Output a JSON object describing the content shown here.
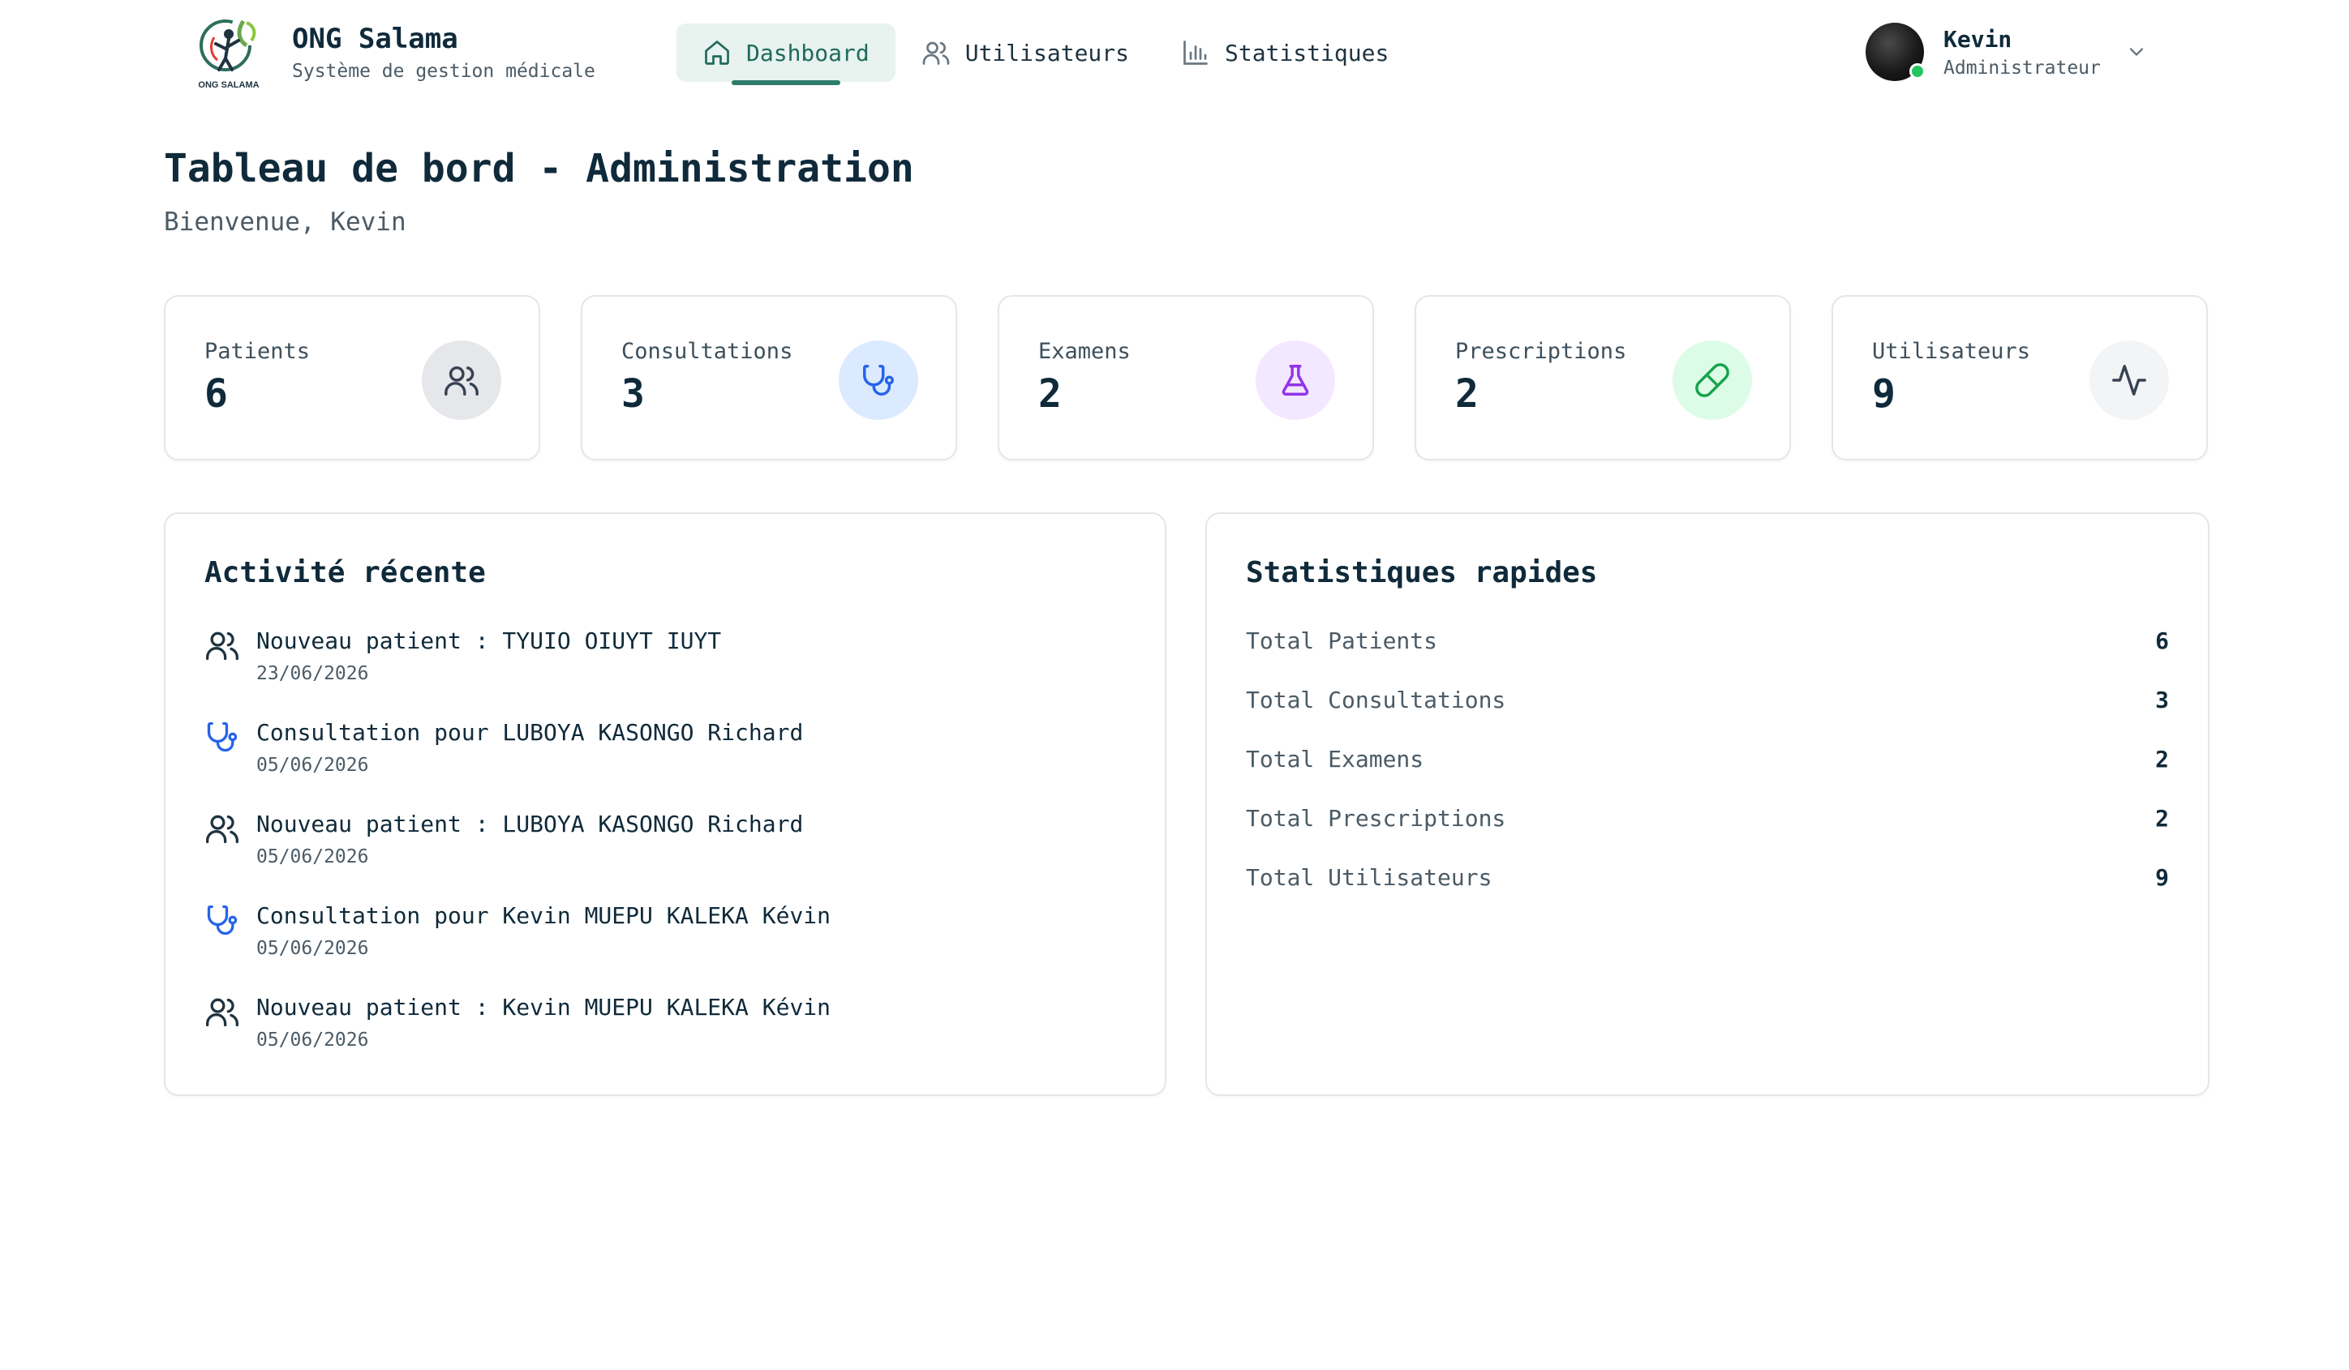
{
  "brand": {
    "title": "ONG Salama",
    "subtitle": "Système de gestion médicale",
    "logo_text": "ONG SALAMA"
  },
  "nav": {
    "items": [
      {
        "label": "Dashboard",
        "icon": "home-icon",
        "active": true
      },
      {
        "label": "Utilisateurs",
        "icon": "users-icon",
        "active": false
      },
      {
        "label": "Statistiques",
        "icon": "bar-chart-icon",
        "active": false
      }
    ]
  },
  "user": {
    "name": "Kevin",
    "role": "Administrateur",
    "status_color": "#22c55e"
  },
  "page": {
    "title": "Tableau de bord - Administration",
    "welcome": "Bienvenue, Kevin"
  },
  "cards": [
    {
      "label": "Patients",
      "value": "6",
      "icon": "users-icon",
      "icon_bg": "#e5e7eb",
      "icon_color": "#374151"
    },
    {
      "label": "Consultations",
      "value": "3",
      "icon": "stethoscope-icon",
      "icon_bg": "#dbeafe",
      "icon_color": "#2563eb"
    },
    {
      "label": "Examens",
      "value": "2",
      "icon": "flask-icon",
      "icon_bg": "#f3e8ff",
      "icon_color": "#9333ea"
    },
    {
      "label": "Prescriptions",
      "value": "2",
      "icon": "pill-icon",
      "icon_bg": "#dcfce7",
      "icon_color": "#16a34a"
    },
    {
      "label": "Utilisateurs",
      "value": "9",
      "icon": "activity-icon",
      "icon_bg": "#f3f4f6",
      "icon_color": "#374151"
    }
  ],
  "activity": {
    "title": "Activité récente",
    "items": [
      {
        "text": "Nouveau patient : TYUIO OIUYT IUYT",
        "date": "23/06/2026",
        "icon": "users-icon"
      },
      {
        "text": "Consultation pour LUBOYA KASONGO Richard",
        "date": "05/06/2026",
        "icon": "stethoscope-icon"
      },
      {
        "text": "Nouveau patient : LUBOYA KASONGO Richard",
        "date": "05/06/2026",
        "icon": "users-icon"
      },
      {
        "text": "Consultation pour Kevin MUEPU KALEKA Kévin",
        "date": "05/06/2026",
        "icon": "stethoscope-icon"
      },
      {
        "text": "Nouveau patient : Kevin MUEPU KALEKA Kévin",
        "date": "05/06/2026",
        "icon": "users-icon"
      }
    ]
  },
  "quick_stats": {
    "title": "Statistiques rapides",
    "rows": [
      {
        "label": "Total Patients",
        "value": "6"
      },
      {
        "label": "Total Consultations",
        "value": "3"
      },
      {
        "label": "Total Examens",
        "value": "2"
      },
      {
        "label": "Total Prescriptions",
        "value": "2"
      },
      {
        "label": "Total Utilisateurs",
        "value": "9"
      }
    ]
  }
}
